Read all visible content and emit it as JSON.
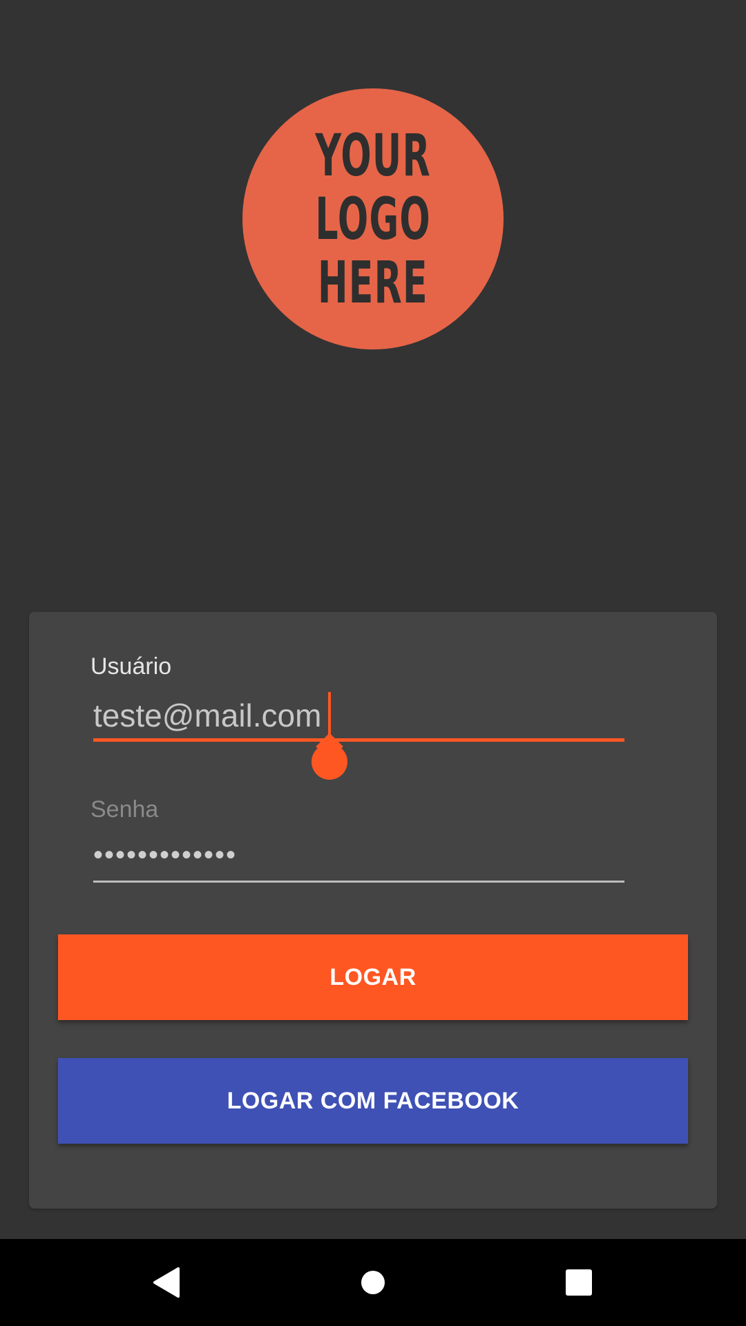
{
  "logo": {
    "lines": [
      "YOUR",
      "LOGO",
      "HERE"
    ]
  },
  "form": {
    "username": {
      "label": "Usuário",
      "value": "teste@mail.com"
    },
    "password": {
      "label": "Senha",
      "value": "•••••••••••••"
    },
    "login_button": "LOGAR",
    "facebook_button": "LOGAR COM FACEBOOK"
  },
  "navigation": {
    "back": "back-icon",
    "home": "home-icon",
    "recents": "recents-icon"
  },
  "colors": {
    "background": "#333333",
    "card": "#444444",
    "accent": "#ff5722",
    "facebook": "#3f51b5",
    "logo": "#e66548"
  }
}
